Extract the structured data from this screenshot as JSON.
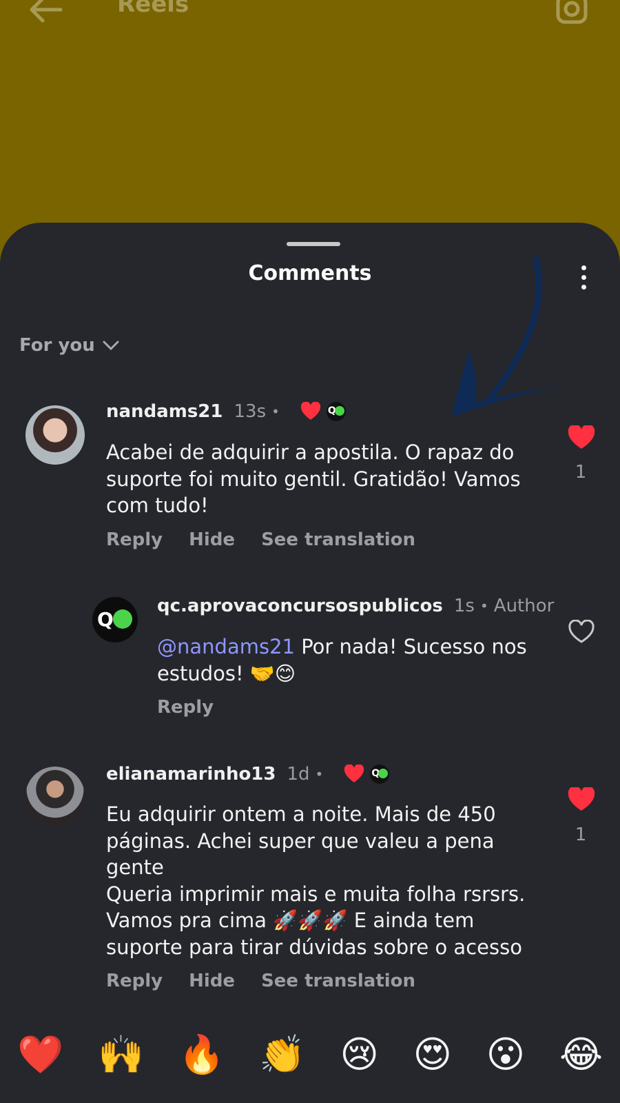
{
  "header": {
    "title": "Reels"
  },
  "sheet": {
    "title": "Comments",
    "sort_label": "For you"
  },
  "comments": [
    {
      "username": "nandams21",
      "time": "13s",
      "text": "Acabei de adquirir a apostila. O rapaz do\nsuporte foi muito gentil. Gratidão! Vamos\ncom tudo!",
      "like_count": "1",
      "actions": {
        "reply": "Reply",
        "hide": "Hide",
        "translate": "See translation"
      }
    },
    {
      "username": "qc.aprovaconcursospublicos",
      "time": "1s",
      "author_tag": "Author",
      "mention": "@nandams21",
      "text": " Por nada! Sucesso nos\nestudos! 🤝😊",
      "actions": {
        "reply": "Reply"
      }
    },
    {
      "username": "elianamarinho13",
      "time": "1d",
      "text": "Eu adquirir ontem a noite. Mais de 450\npáginas. Achei super que valeu a pena\ngente\nQueria imprimir mais e muita folha rsrsrs.\nVamos pra cima 🚀🚀🚀 E ainda tem\nsuporte para tirar dúvidas sobre o acesso",
      "like_count": "1",
      "actions": {
        "reply": "Reply",
        "hide": "Hide",
        "translate": "See translation"
      }
    }
  ],
  "reactions": [
    "❤️",
    "🙌",
    "🔥",
    "👏",
    "😢",
    "😍",
    "😮",
    "😂"
  ],
  "colors": {
    "accent_heart": "#ff3040",
    "mention": "#8f96ff",
    "sheet_bg": "#25272c",
    "reel_bg": "#7a6400"
  }
}
